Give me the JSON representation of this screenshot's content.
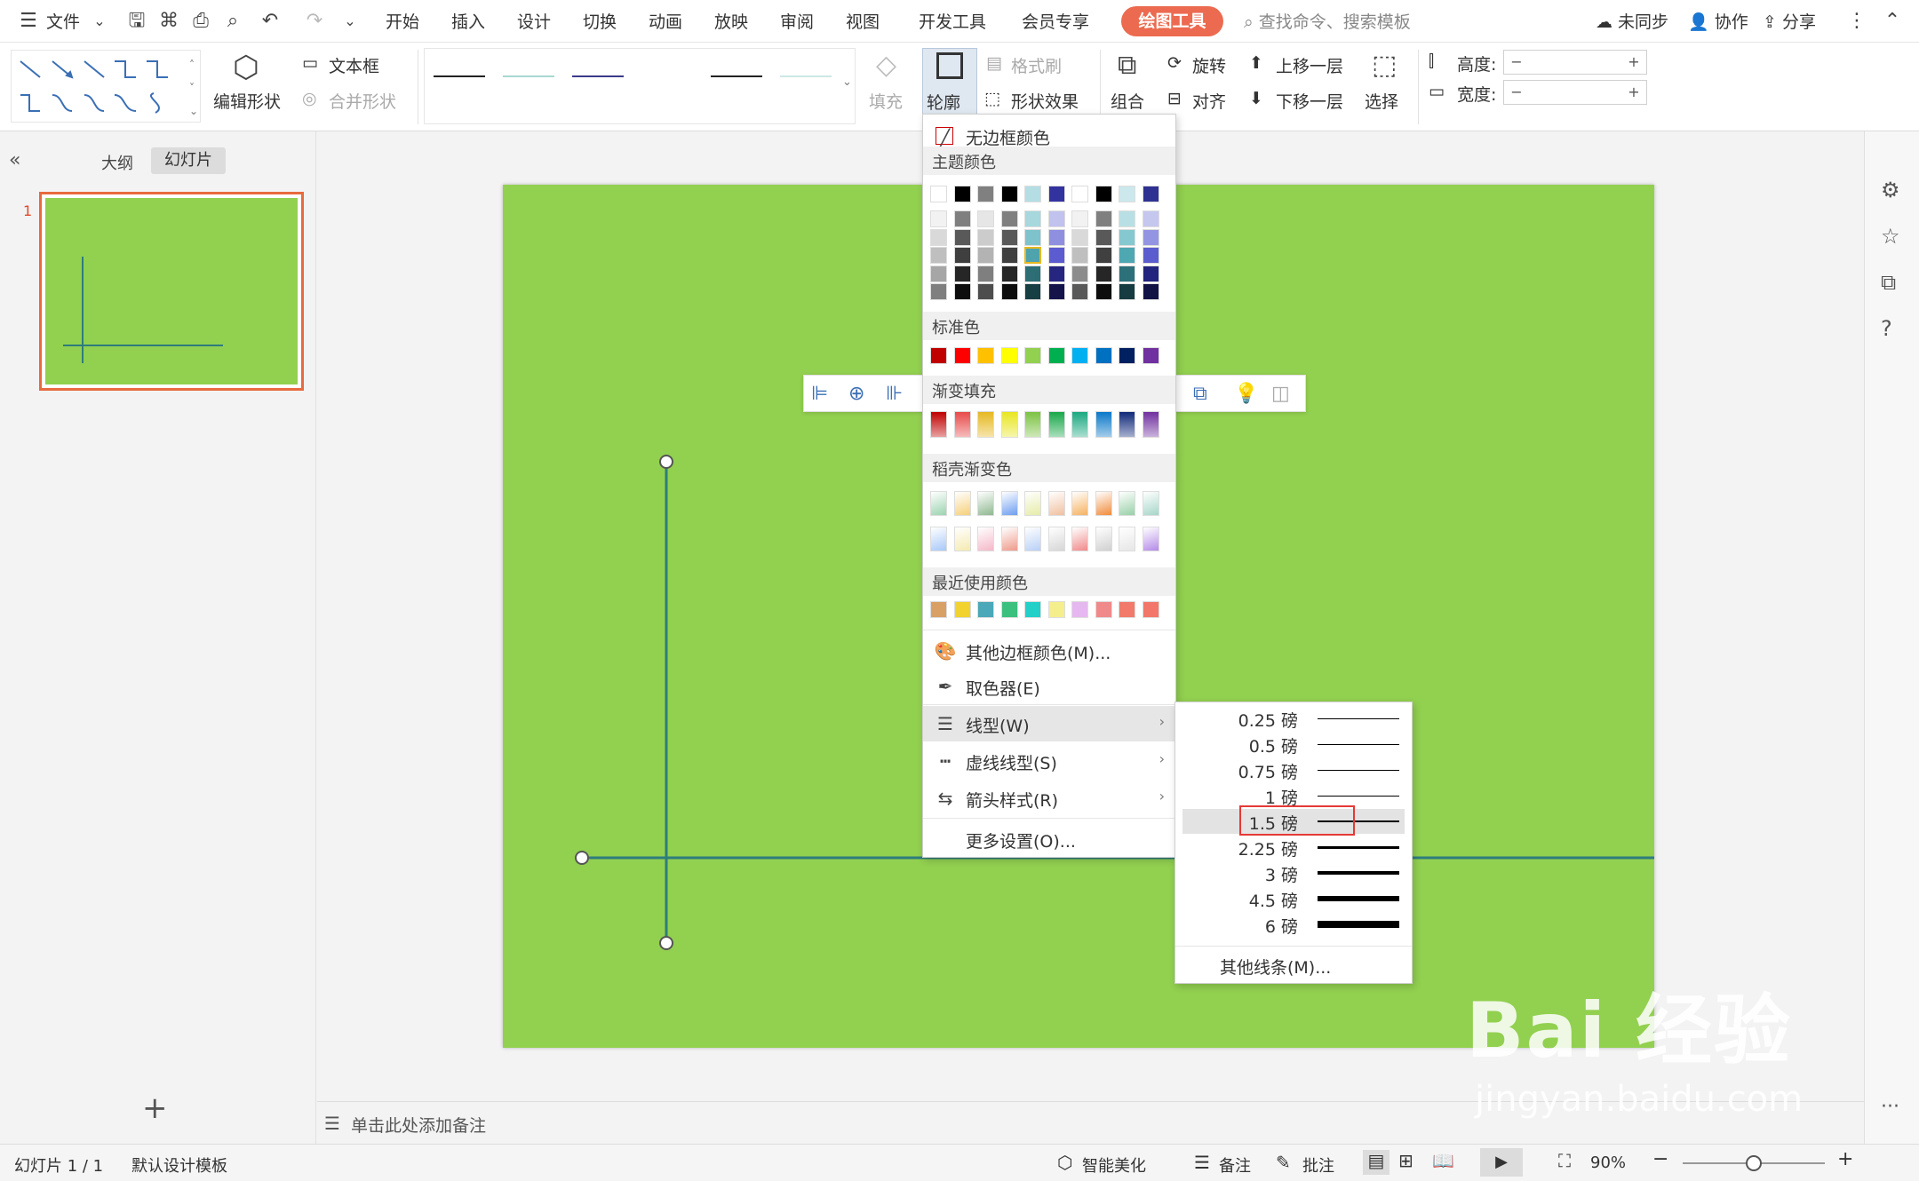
{
  "menubar": {
    "file_label": "文件",
    "tabs": [
      "开始",
      "插入",
      "设计",
      "切换",
      "动画",
      "放映",
      "审阅",
      "视图",
      "开发工具",
      "会员专享"
    ],
    "active_tool_tab": "绘图工具",
    "search_placeholder": "查找命令、搜索模板",
    "sync_label": "未同步",
    "collab_label": "协作",
    "share_label": "分享"
  },
  "ribbon": {
    "edit_shape": "编辑形状",
    "textbox": "文本框",
    "merge_shape": "合并形状",
    "fill": "填充",
    "outline": "轮廓",
    "format_brush": "格式刷",
    "shape_effect": "形状效果",
    "group": "组合",
    "rotate": "旋转",
    "align": "对齐",
    "bring_forward": "上移一层",
    "send_backward": "下移一层",
    "select": "选择",
    "height_label": "高度:",
    "width_label": "宽度:",
    "minus": "−",
    "plus": "+",
    "line_style_colors": [
      "#222222",
      "#a8d8d0",
      "#3a3a8a",
      "#ffffff",
      "#222222",
      "#cde8e4"
    ]
  },
  "leftpanel": {
    "collapse_icon": "«",
    "tab_outline": "大纲",
    "tab_slides": "幻灯片",
    "slide_number": "1",
    "add_slide": "+"
  },
  "notes": {
    "placeholder": "单击此处添加备注"
  },
  "statusbar": {
    "slide_info": "幻灯片 1 / 1",
    "template": "默认设计模板",
    "smart_beautify": "智能美化",
    "notes": "备注",
    "comment": "批注",
    "zoom": "90%",
    "zoom_level": 0.5
  },
  "outline_menu": {
    "no_border": "无边框颜色",
    "theme_colors_title": "主题颜色",
    "standard_colors_title": "标准色",
    "gradient_fill_title": "渐变填充",
    "docer_gradient_title": "稻壳渐变色",
    "recent_colors_title": "最近使用颜色",
    "more_border_colors": "其他边框颜色(M)...",
    "eyedropper": "取色器(E)",
    "line_weight": "线型(W)",
    "dash_type": "虚线线型(S)",
    "arrow_style": "箭头样式(R)",
    "more_settings": "更多设置(O)...",
    "theme_top_row": [
      "#ffffff",
      "#000000",
      "#808080",
      "#000000",
      "#b4dee4",
      "#3333a0",
      "#ffffff",
      "#000000",
      "#cce8ec",
      "#2e3192"
    ],
    "theme_columns": [
      [
        "#f2f2f2",
        "#d9d9d9",
        "#bfbfbf",
        "#a6a6a6",
        "#7f7f7f"
      ],
      [
        "#7f7f7f",
        "#595959",
        "#3f3f3f",
        "#262626",
        "#0d0d0d"
      ],
      [
        "#e6e6e6",
        "#cccccc",
        "#b3b3b3",
        "#7f7f7f",
        "#4d4d4d"
      ],
      [
        "#7f7f7f",
        "#595959",
        "#404040",
        "#262626",
        "#0d0d0d"
      ],
      [
        "#a6d8dd",
        "#7ec3cb",
        "#4fa3ad",
        "#2d6e75",
        "#173e42"
      ],
      [
        "#c2c2ef",
        "#8f8fe0",
        "#5c5cd0",
        "#262680",
        "#14144a"
      ],
      [
        "#f2f2f2",
        "#d9d9d9",
        "#bfbfbf",
        "#8c8c8c",
        "#595959"
      ],
      [
        "#7f7f7f",
        "#595959",
        "#404040",
        "#262626",
        "#0d0d0d"
      ],
      [
        "#b8e0e4",
        "#86c8cf",
        "#4ea8b2",
        "#2c7079",
        "#163b40"
      ],
      [
        "#c6c7ef",
        "#9495e2",
        "#5b5dce",
        "#22247d",
        "#121345"
      ]
    ],
    "standard_colors": [
      "#c00000",
      "#ff0000",
      "#ffc000",
      "#ffff00",
      "#92d050",
      "#00b050",
      "#00b0f0",
      "#0070c0",
      "#002060",
      "#7030a0"
    ],
    "gradient_colors": [
      "#c00000",
      "#e84a4a",
      "#e6b820",
      "#e8e620",
      "#7cc242",
      "#18a84a",
      "#1aa880",
      "#0a78c8",
      "#102a7a",
      "#7030a0"
    ],
    "docer_row1": [
      "#9cd3b0",
      "#f6d07a",
      "#8fb890",
      "#6e9ef0",
      "#e6eca8",
      "#f0c0a0",
      "#f5b260",
      "#f08c3c",
      "#98d0a8",
      "#a6d6c8"
    ],
    "docer_row2": [
      "#a8c8f8",
      "#f5eab0",
      "#f4b8c8",
      "#ee9a8c",
      "#b8d0f6",
      "#d6d6d6",
      "#f08a8a",
      "#d0d0d0",
      "#e6e6e6",
      "#b48ae8"
    ],
    "recent_colors": [
      "#d9a065",
      "#f2d22e",
      "#4aa8b8",
      "#3cc07e",
      "#22d0c8",
      "#f5ee8c",
      "#e6b8f0",
      "#f08a8a",
      "#f27a6a",
      "#f2776a"
    ]
  },
  "weight_menu": {
    "items": [
      {
        "label": "0.25 磅",
        "weight": 0.25
      },
      {
        "label": "0.5 磅",
        "weight": 0.5
      },
      {
        "label": "0.75 磅",
        "weight": 0.75
      },
      {
        "label": "1 磅",
        "weight": 1
      },
      {
        "label": "1.5 磅",
        "weight": 1.5,
        "selected": true
      },
      {
        "label": "2.25 磅",
        "weight": 2.25
      },
      {
        "label": "3 磅",
        "weight": 3
      },
      {
        "label": "4.5 磅",
        "weight": 4.5
      },
      {
        "label": "6 磅",
        "weight": 6
      }
    ],
    "more_lines": "其他线条(M)..."
  },
  "watermark": {
    "logo_text": "Bai 经验",
    "url_text": "jingyan.baidu.com"
  },
  "colors": {
    "slide_bg": "#92d050",
    "line_color": "#2e7d7d",
    "accent": "#ec6a4f",
    "highlight_box": "#e53935"
  }
}
